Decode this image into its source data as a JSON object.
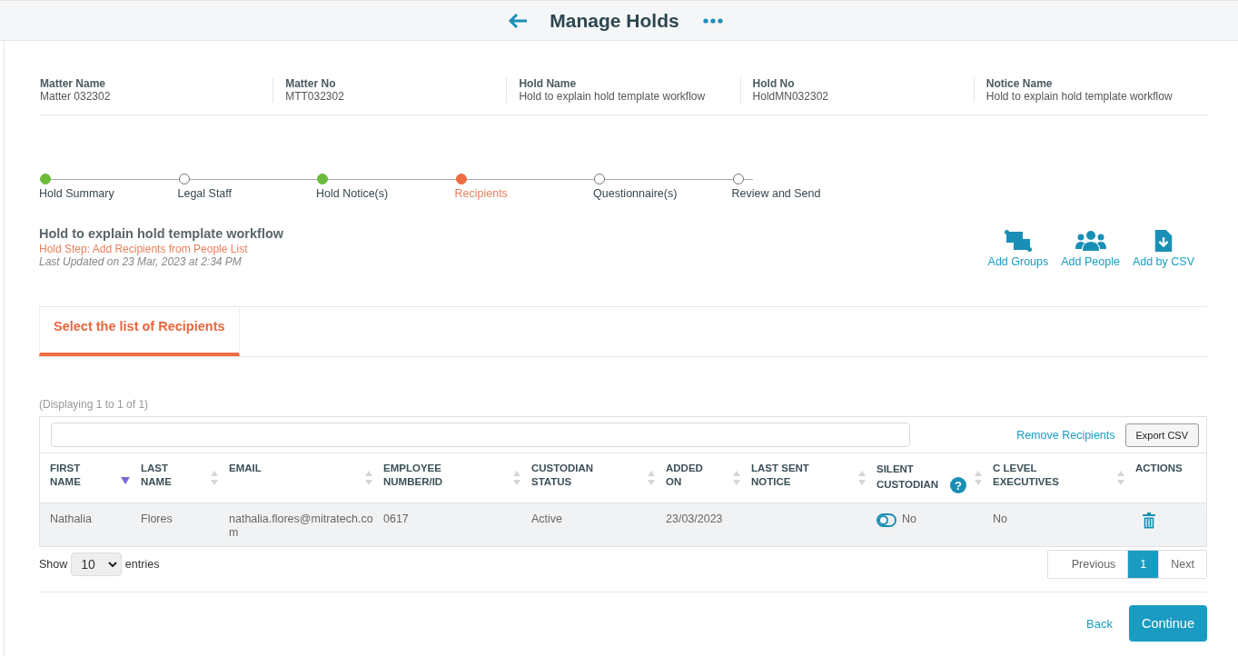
{
  "header": {
    "title": "Manage Holds"
  },
  "info": [
    {
      "label": "Matter Name",
      "value": "Matter 032302"
    },
    {
      "label": "Matter No",
      "value": "MTT032302"
    },
    {
      "label": "Hold Name",
      "value": "Hold to explain hold template workflow"
    },
    {
      "label": "Hold No",
      "value": "HoldMN032302"
    },
    {
      "label": "Notice Name",
      "value": "Hold to explain hold template workflow"
    }
  ],
  "steps": [
    {
      "label": "Hold Summary",
      "completed": true,
      "selected": false
    },
    {
      "label": "Legal Staff",
      "completed": false,
      "selected": false
    },
    {
      "label": "Hold Notice(s)",
      "completed": true,
      "selected": false
    },
    {
      "label": "Recipients",
      "completed": false,
      "selected": true
    },
    {
      "label": "Questionnaire(s)",
      "completed": false,
      "selected": false
    },
    {
      "label": "Review and Send",
      "completed": false,
      "selected": false
    }
  ],
  "hold": {
    "title": "Hold to explain hold template workflow",
    "step": "Hold Step: Add Recipients from People List",
    "updated": "Last Updated on 23 Mar, 2023 at 2:34 PM"
  },
  "actions": [
    {
      "kind": "groups",
      "label": "Add Groups"
    },
    {
      "kind": "people",
      "label": "Add People"
    },
    {
      "kind": "csv",
      "label": "Add by CSV"
    }
  ],
  "tabs": [
    {
      "label": "Select the list of Recipients",
      "selected": true
    }
  ],
  "displaying": "(Displaying 1 to 1 of 1)",
  "remove_link": "Remove Recipients",
  "export_button": "Export CSV",
  "columns": [
    {
      "label": "FIRST NAME",
      "sortable": true,
      "sorted": true
    },
    {
      "label": "LAST NAME",
      "sortable": true,
      "sorted": false
    },
    {
      "label": "EMAIL",
      "sortable": true,
      "sorted": false
    },
    {
      "label": "EMPLOYEE NUMBER/ID",
      "sortable": true,
      "sorted": false
    },
    {
      "label": "CUSTODIAN STATUS",
      "sortable": true,
      "sorted": false
    },
    {
      "label": "ADDED ON",
      "sortable": true,
      "sorted": false
    },
    {
      "label": "LAST SENT NOTICE",
      "sortable": true,
      "sorted": false
    },
    {
      "label": "SILENT CUSTODIAN",
      "sortable": true,
      "sorted": false,
      "help": "?"
    },
    {
      "label": "C LEVEL EXECUTIVES",
      "sortable": true,
      "sorted": false
    },
    {
      "label": "ACTIONS",
      "sortable": false,
      "sorted": false
    }
  ],
  "rows": [
    {
      "first_name": "Nathalia",
      "last_name": "Flores",
      "email": "nathalia.flores@mitratech.com",
      "employee_id": "0617",
      "status": "Active",
      "added_on": "23/03/2023",
      "silent_on": false,
      "silent_label": "No",
      "c_level": "No"
    }
  ],
  "page_size": {
    "before": "Show",
    "value": "10",
    "after": "entries"
  },
  "pagination": [
    {
      "label": "Previous",
      "selected": false
    },
    {
      "label": "1",
      "selected": true
    },
    {
      "label": "Next",
      "selected": false
    }
  ],
  "footer": {
    "back": "Back",
    "continue": "Continue"
  }
}
